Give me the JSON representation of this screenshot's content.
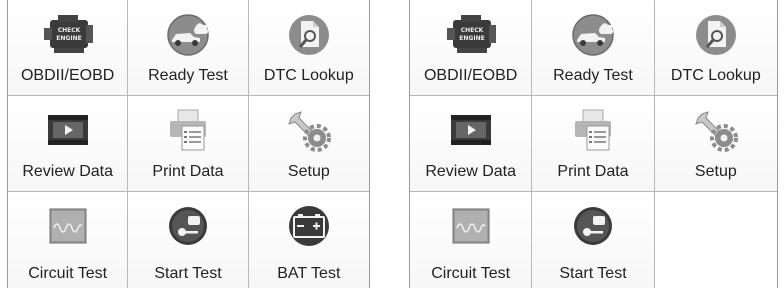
{
  "panels": [
    {
      "tiles": [
        {
          "label": "OBDII/EOBD",
          "icon": "check-engine-icon"
        },
        {
          "label": "Ready Test",
          "icon": "ready-test-car-icon"
        },
        {
          "label": "DTC Lookup",
          "icon": "document-search-icon"
        },
        {
          "label": "Review Data",
          "icon": "video-play-icon"
        },
        {
          "label": "Print Data",
          "icon": "printer-icon"
        },
        {
          "label": "Setup",
          "icon": "wrench-gear-icon"
        },
        {
          "label": "Circuit Test",
          "icon": "waveform-icon"
        },
        {
          "label": "Start Test",
          "icon": "engine-key-icon"
        },
        {
          "label": "BAT Test",
          "icon": "battery-icon"
        }
      ]
    },
    {
      "tiles": [
        {
          "label": "OBDII/EOBD",
          "icon": "check-engine-icon"
        },
        {
          "label": "Ready Test",
          "icon": "ready-test-car-icon"
        },
        {
          "label": "DTC Lookup",
          "icon": "document-search-icon"
        },
        {
          "label": "Review Data",
          "icon": "video-play-icon"
        },
        {
          "label": "Print Data",
          "icon": "printer-icon"
        },
        {
          "label": "Setup",
          "icon": "wrench-gear-icon"
        },
        {
          "label": "Circuit Test",
          "icon": "waveform-icon"
        },
        {
          "label": "Start Test",
          "icon": "engine-key-icon"
        }
      ]
    }
  ],
  "icon_text": {
    "check_engine_line1": "CHECK",
    "check_engine_line2": "ENGINE"
  },
  "colors": {
    "icon_dark": "#3a3a3a",
    "icon_mid": "#8c8c8c",
    "grid_line": "#b8b8b8"
  }
}
